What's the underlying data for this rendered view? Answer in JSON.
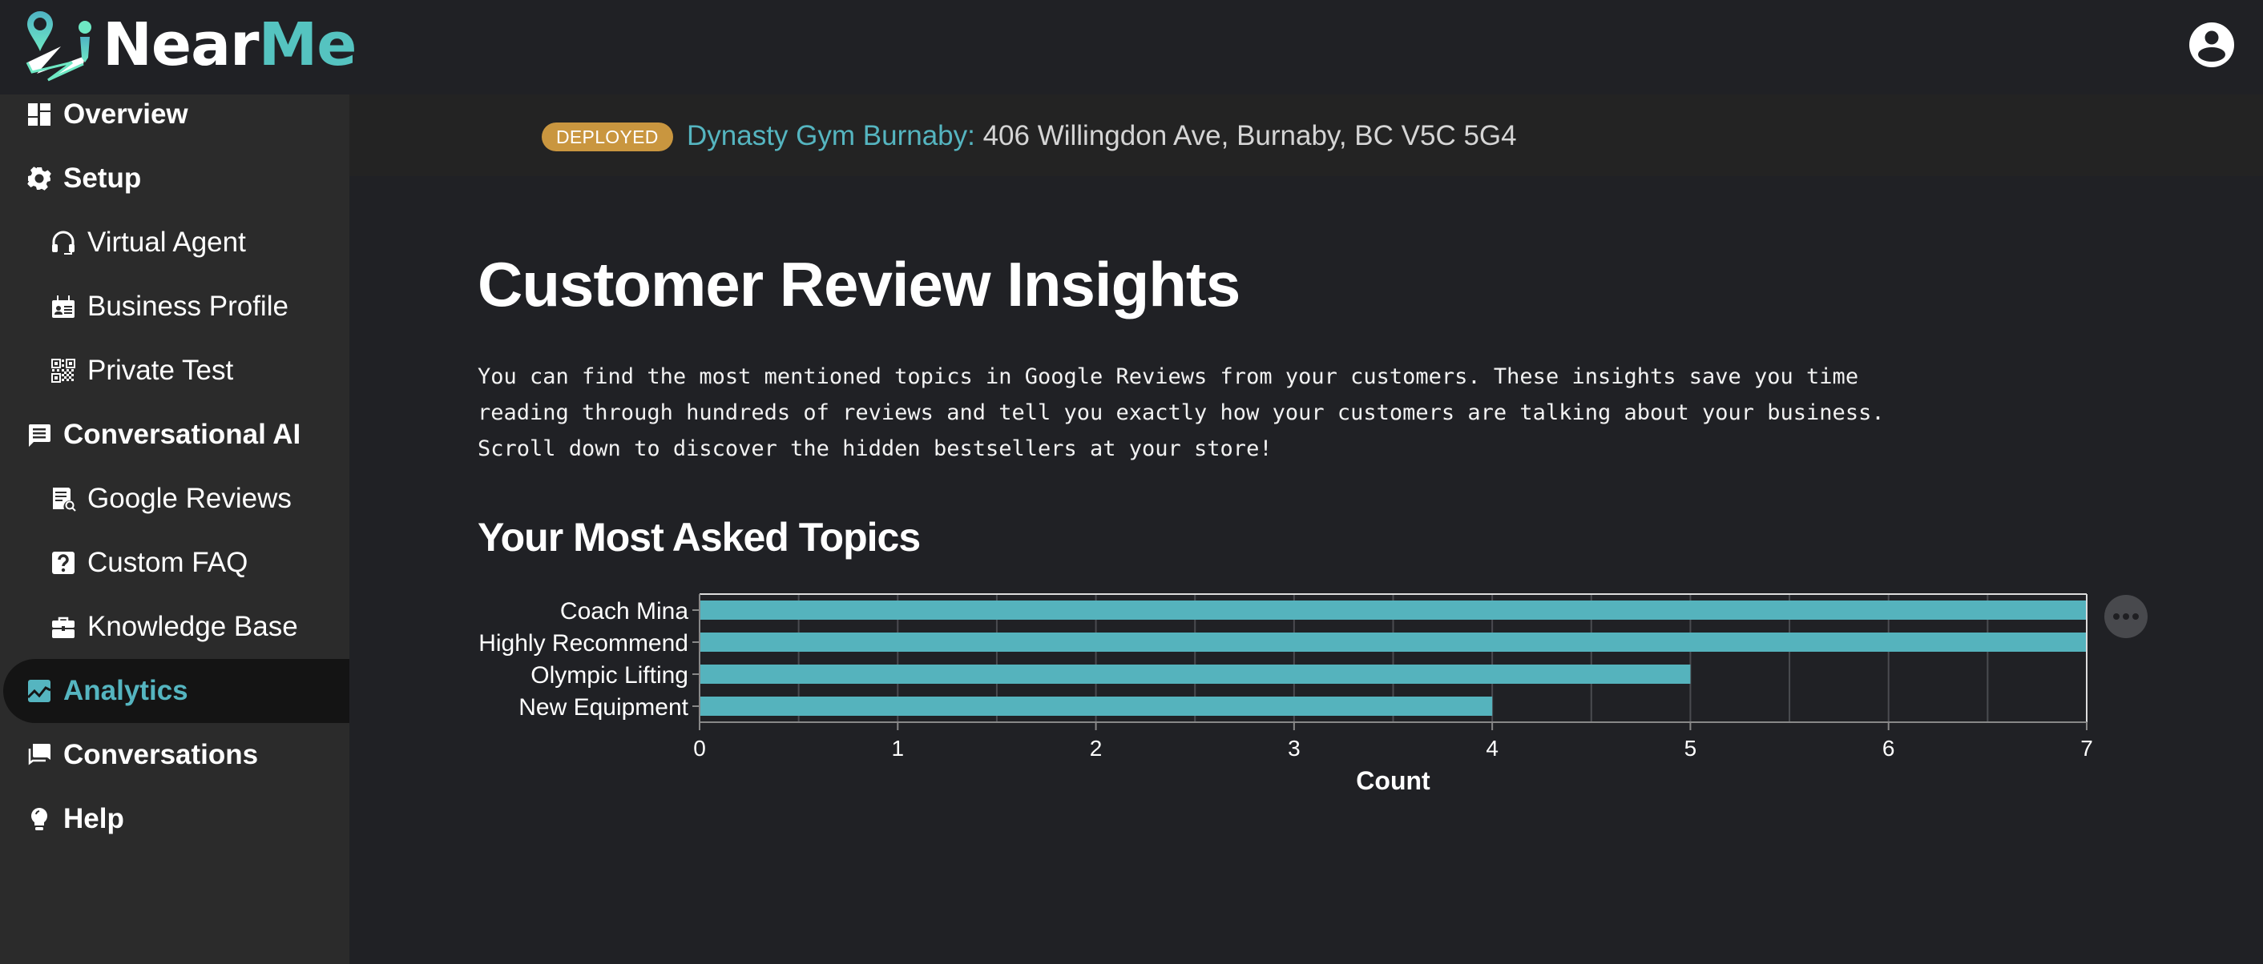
{
  "app": {
    "logo_text_part1": "Near",
    "logo_text_part2": "Me",
    "brand_color": "#55c3c0",
    "accent_color": "#55b5c0"
  },
  "header": {
    "user_icon": "account-circle-icon"
  },
  "sidebar": {
    "items": [
      {
        "label": "Overview",
        "icon": "dashboard-icon",
        "level": "top",
        "active": false
      },
      {
        "label": "Setup",
        "icon": "gear-icon",
        "level": "top",
        "active": false
      },
      {
        "label": "Virtual Agent",
        "icon": "headset-icon",
        "level": "sub",
        "active": false
      },
      {
        "label": "Business Profile",
        "icon": "id-card-icon",
        "level": "sub",
        "active": false
      },
      {
        "label": "Private Test",
        "icon": "qr-code-icon",
        "level": "sub",
        "active": false
      },
      {
        "label": "Conversational AI",
        "icon": "chat-bubble-icon",
        "level": "top",
        "active": false
      },
      {
        "label": "Google Reviews",
        "icon": "document-search-icon",
        "level": "sub",
        "active": false
      },
      {
        "label": "Custom FAQ",
        "icon": "question-box-icon",
        "level": "sub",
        "active": false
      },
      {
        "label": "Knowledge Base",
        "icon": "briefcase-icon",
        "level": "sub",
        "active": false
      },
      {
        "label": "Analytics",
        "icon": "chart-line-icon",
        "level": "top",
        "active": true
      },
      {
        "label": "Conversations",
        "icon": "chats-icon",
        "level": "top",
        "active": false
      },
      {
        "label": "Help",
        "icon": "lightbulb-icon",
        "level": "top",
        "active": false
      }
    ]
  },
  "banner": {
    "status": "DEPLOYED",
    "status_color": "#c9963f",
    "business_name": "Dynasty Gym Burnaby:",
    "address": " 406 Willingdon Ave, Burnaby, BC V5C 5G4"
  },
  "main": {
    "title": "Customer Review Insights",
    "description_lines": [
      "You can find the most mentioned topics in Google Reviews from your customers. These insights save you time",
      "reading through hundreds of reviews and tell you exactly how your customers are talking about your business.",
      "Scroll down to discover the hidden bestsellers at your store!"
    ],
    "section_title": "Your Most Asked Topics",
    "chart_menu_icon": "more-horizontal-icon"
  },
  "chart_data": {
    "type": "bar",
    "orientation": "horizontal",
    "title": "Your Most Asked Topics",
    "categories": [
      "Coach Mina",
      "Highly Recommend",
      "Olympic Lifting",
      "New Equipment"
    ],
    "values": [
      7,
      7,
      5,
      4
    ],
    "xlabel": "Count",
    "ylabel": "",
    "xlim": [
      0,
      7
    ],
    "x_ticks": [
      0,
      1,
      2,
      3,
      4,
      5,
      6,
      7
    ],
    "grid_step": 0.5,
    "grid": true,
    "bar_color": "#55b3bd",
    "legend": "none"
  }
}
